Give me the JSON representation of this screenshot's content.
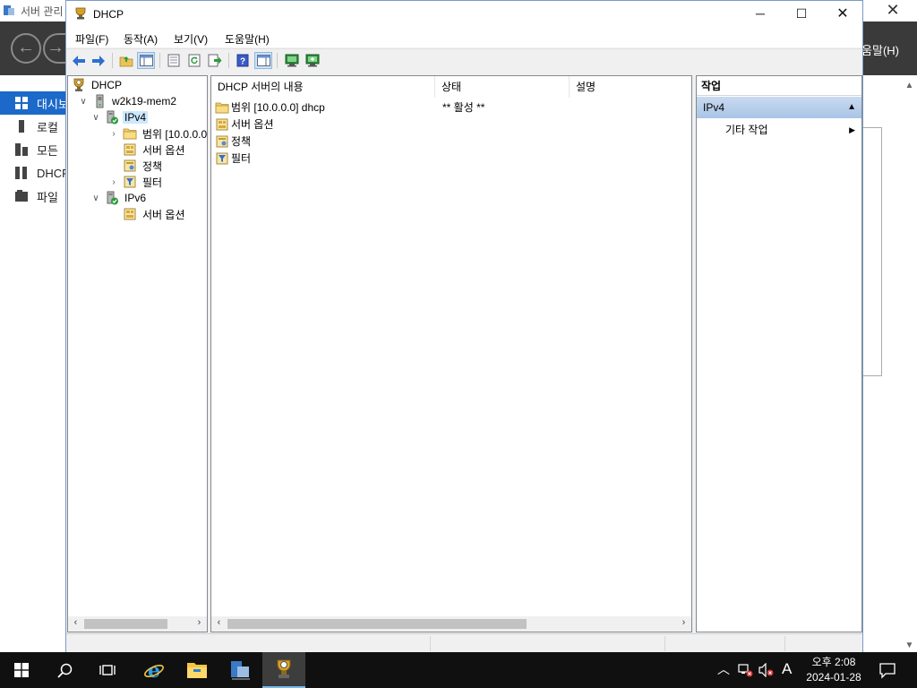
{
  "background_window": {
    "title": "서버 관리",
    "help_label": "움말(H)",
    "close_glyph": "✕",
    "sidebar": [
      {
        "label": "대시보",
        "icon": "dashboard-icon",
        "active": true
      },
      {
        "label": "로컬",
        "icon": "local-server-icon",
        "active": false
      },
      {
        "label": "모든",
        "icon": "all-servers-icon",
        "active": false
      },
      {
        "label": "DHCP",
        "icon": "dhcp-role-icon",
        "active": false
      },
      {
        "label": "파일",
        "icon": "file-services-icon",
        "active": false
      }
    ]
  },
  "window": {
    "title": "DHCP",
    "controls": {
      "minimize": "─",
      "maximize": "☐",
      "close": "✕"
    }
  },
  "menu": [
    "파일(F)",
    "동작(A)",
    "보기(V)",
    "도움말(H)"
  ],
  "toolbar": [
    {
      "icon": "back-arrow-icon"
    },
    {
      "icon": "forward-arrow-icon"
    },
    {
      "icon": "up-folder-icon"
    },
    {
      "icon": "show-hide-tree-icon"
    },
    {
      "icon": "properties-icon"
    },
    {
      "icon": "refresh-icon"
    },
    {
      "icon": "export-list-icon"
    },
    {
      "icon": "help-icon"
    },
    {
      "icon": "show-hide-action-pane-icon"
    },
    {
      "icon": "display-statistics-icon"
    },
    {
      "icon": "add-server-icon"
    }
  ],
  "tree": [
    {
      "label": "DHCP",
      "expander": "",
      "icon": "dhcp-icon",
      "selected": false
    },
    {
      "label": "w2k19-mem2",
      "expander": "∨",
      "icon": "server-icon",
      "selected": false
    },
    {
      "label": "IPv4",
      "expander": "∨",
      "icon": "ipv4-icon",
      "selected": true
    },
    {
      "label": "범위 [10.0.0.0",
      "expander": "›",
      "icon": "scope-folder-icon",
      "selected": false
    },
    {
      "label": "서버 옵션",
      "expander": "",
      "icon": "server-options-icon",
      "selected": false
    },
    {
      "label": "정책",
      "expander": "",
      "icon": "policies-icon",
      "selected": false
    },
    {
      "label": "필터",
      "expander": "›",
      "icon": "filters-icon",
      "selected": false
    },
    {
      "label": "IPv6",
      "expander": "∨",
      "icon": "ipv6-icon",
      "selected": false
    },
    {
      "label": "서버 옵션",
      "expander": "",
      "icon": "server-options-icon",
      "selected": false
    }
  ],
  "list": {
    "columns": [
      "DHCP 서버의 내용",
      "상태",
      "설명"
    ],
    "rows": [
      {
        "name": "범위 [10.0.0.0] dhcp",
        "status": "** 활성 **",
        "icon": "scope-folder-icon"
      },
      {
        "name": "서버 옵션",
        "status": "",
        "icon": "server-options-icon"
      },
      {
        "name": "정책",
        "status": "",
        "icon": "policies-icon"
      },
      {
        "name": "필터",
        "status": "",
        "icon": "filters-icon"
      }
    ]
  },
  "actions": {
    "title": "작업",
    "section": "IPv4",
    "items": [
      "기타 작업"
    ]
  },
  "taskbar": {
    "time": "오후 2:08",
    "date": "2024-01-28",
    "ime": "A",
    "apps": [
      "start-icon",
      "search-icon",
      "task-view-icon",
      "internet-explorer-icon",
      "file-explorer-icon",
      "server-manager-icon",
      "dhcp-console-icon"
    ]
  },
  "colors": {
    "accent": "#1c69c9",
    "selected_tree": "#cce8ff",
    "action_header": "#b8cfec",
    "taskbar": "#101010"
  }
}
